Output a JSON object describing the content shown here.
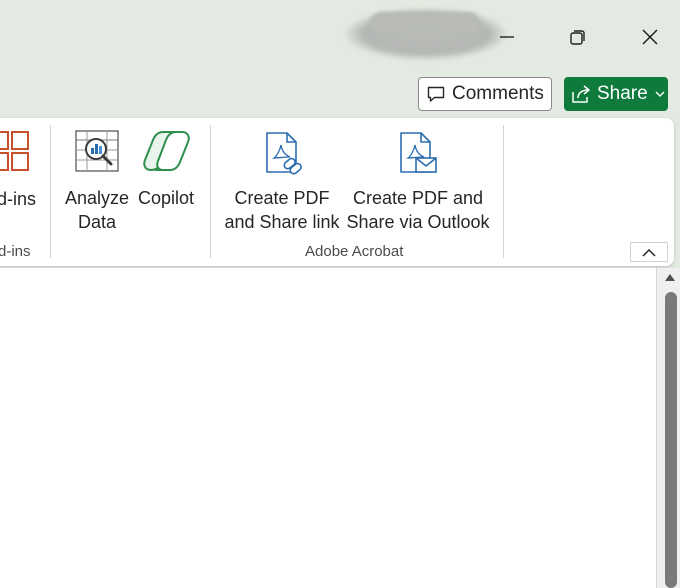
{
  "window": {
    "minimize_icon": "minimize-icon",
    "restore_icon": "restore-icon",
    "close_icon": "close-icon"
  },
  "toolbar": {
    "comments_label": "Comments",
    "share_label": "Share"
  },
  "ribbon": {
    "addins_partial_label": "d-ins",
    "addins_group_partial_label": "d-ins",
    "analyze_data": {
      "line1": "Analyze",
      "line2": "Data"
    },
    "copilot": {
      "line1": "Copilot"
    },
    "create_pdf_share_link": {
      "line1": "Create PDF",
      "line2": "and Share link"
    },
    "create_pdf_outlook": {
      "line1": "Create PDF and",
      "line2": "Share via Outlook"
    },
    "adobe_group_label": "Adobe Acrobat"
  },
  "colors": {
    "share_green": "#0e7a3c",
    "addins_orange": "#c8502a",
    "acrobat_blue": "#2b6cb0",
    "copilot_green": "#2f8f4e"
  }
}
